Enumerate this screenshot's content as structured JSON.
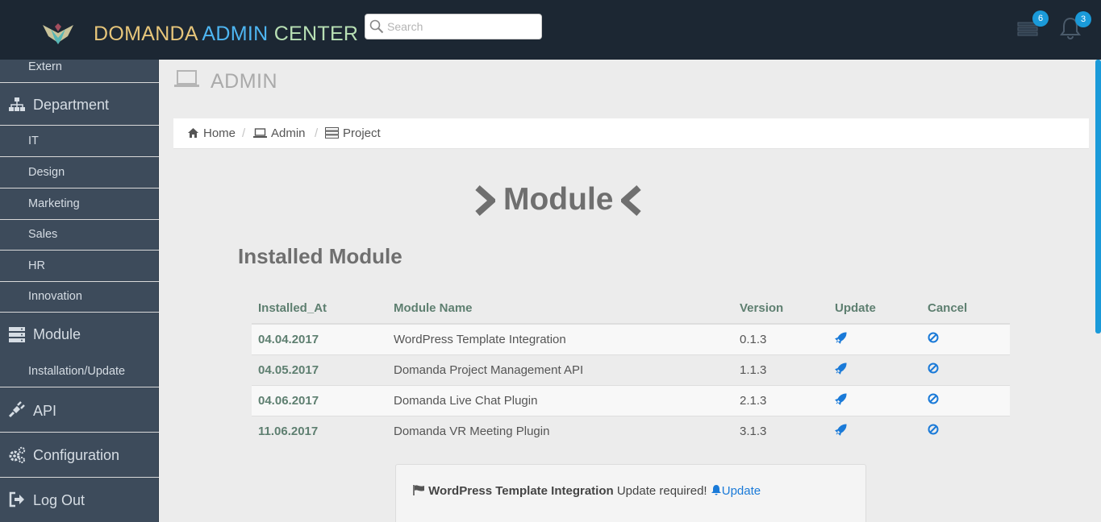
{
  "header": {
    "brand_part1": "DOMANDA",
    "brand_part2": "ADMIN",
    "brand_part3": "CENTER",
    "search_placeholder": "Search",
    "messages_count": "6",
    "notifications_count": "3"
  },
  "sidebar": {
    "items": [
      {
        "label": "Extern",
        "type": "sub"
      },
      {
        "label": "Department",
        "type": "head",
        "icon": "sitemap-icon"
      },
      {
        "label": "IT",
        "type": "sub"
      },
      {
        "label": "Design",
        "type": "sub"
      },
      {
        "label": "Marketing",
        "type": "sub"
      },
      {
        "label": "Sales",
        "type": "sub"
      },
      {
        "label": "HR",
        "type": "sub"
      },
      {
        "label": "Innovation",
        "type": "sub"
      },
      {
        "label": "Module",
        "type": "head",
        "icon": "server-icon"
      },
      {
        "label": "Installation/Update",
        "type": "sub"
      },
      {
        "label": "API",
        "type": "head",
        "icon": "plug-icon"
      },
      {
        "label": "Configuration",
        "type": "head",
        "icon": "gears-icon"
      },
      {
        "label": "Log Out",
        "type": "head",
        "icon": "sign-out-icon"
      }
    ]
  },
  "page": {
    "title": "ADMIN",
    "breadcrumb": [
      "Home",
      "Admin",
      "Project"
    ],
    "module_title": "Module",
    "installed_title": "Installed Module"
  },
  "table": {
    "headers": [
      "Installed_At",
      "Module Name",
      "Version",
      "Update",
      "Cancel"
    ],
    "rows": [
      {
        "date": "04.04.2017",
        "name": "WordPress Template Integration",
        "version": "0.1.3"
      },
      {
        "date": "04.05.2017",
        "name": "Domanda Project Management API",
        "version": "1.1.3"
      },
      {
        "date": "04.06.2017",
        "name": "Domanda Live Chat Plugin",
        "version": "2.1.3"
      },
      {
        "date": "11.06.2017",
        "name": "Domanda VR Meeting Plugin",
        "version": "3.1.3"
      }
    ]
  },
  "notice": {
    "module": "WordPress Template Integration",
    "message": " Update required! ",
    "link": "Update"
  },
  "colors": {
    "header_bg": "#1c2733",
    "sidebar_bg": "#3d4b5b",
    "accent_blue": "#1a9ad9",
    "link_blue": "#1a7ad8",
    "table_header_green": "#5e7f70"
  }
}
